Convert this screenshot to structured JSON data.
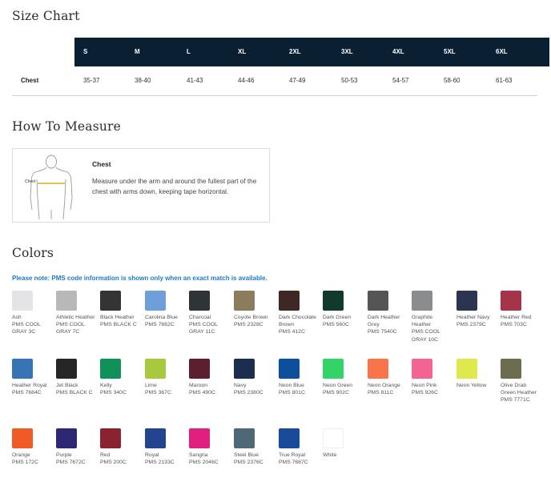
{
  "size_chart": {
    "title": "Size Chart",
    "sizes": [
      "S",
      "M",
      "L",
      "XL",
      "2XL",
      "3XL",
      "4XL",
      "5XL",
      "6XL"
    ],
    "row_label": "Chest",
    "chest_values": [
      "35-37",
      "38-40",
      "41-43",
      "44-46",
      "47-49",
      "50-53",
      "54-57",
      "58-60",
      "61-63"
    ]
  },
  "how_to_measure": {
    "title": "How To Measure",
    "figure_label": "Chest",
    "heading": "Chest",
    "text": "Measure under the arm and around the fullest part of the chest with arms down, keeping tape horizontal.",
    "accent_color": "#d6b21a"
  },
  "colors_section": {
    "title": "Colors",
    "note": "Please note: PMS code information is shown only when an exact match is available.",
    "note_color": "#1f78c8",
    "swatches": [
      {
        "name": "Ash",
        "pms": "PMS COOL GRAY 3C",
        "hex": "#e4e4e6"
      },
      {
        "name": "Athletic Heather",
        "pms": "PMS COOL GRAY 7C",
        "hex": "#b8b8b8"
      },
      {
        "name": "Black Heather",
        "pms": "PMS BLACK C",
        "hex": "#343434"
      },
      {
        "name": "Carolina Blue",
        "pms": "PMS 7682C",
        "hex": "#6f9fda"
      },
      {
        "name": "Charcoal",
        "pms": "PMS COOL GRAY 11C",
        "hex": "#2f3437"
      },
      {
        "name": "Coyote Brown",
        "pms": "PMS 2328C",
        "hex": "#8a7c5d"
      },
      {
        "name": "Dark Chocolate Brown",
        "pms": "PMS 412C",
        "hex": "#3f2725"
      },
      {
        "name": "Dark Green",
        "pms": "PMS 560C",
        "hex": "#103b2b"
      },
      {
        "name": "Dark Heather Grey",
        "pms": "PMS 7540C",
        "hex": "#535557"
      },
      {
        "name": "Graphite Heather",
        "pms": "PMS COOL GRAY 10C",
        "hex": "#8b8c8e"
      },
      {
        "name": "Heather Navy",
        "pms": "PMS 2379C",
        "hex": "#2c3550"
      },
      {
        "name": "Heather Red",
        "pms": "PMS 703C",
        "hex": "#a5344a"
      },
      {
        "name": "Heather Royal",
        "pms": "PMS 7684C",
        "hex": "#3674b5"
      },
      {
        "name": "Jet Black",
        "pms": "PMS BLACK C",
        "hex": "#262626"
      },
      {
        "name": "Kelly",
        "pms": "PMS 340C",
        "hex": "#11915a"
      },
      {
        "name": "Lime",
        "pms": "PMS 367C",
        "hex": "#a8c83d"
      },
      {
        "name": "Maroon",
        "pms": "PMS 490C",
        "hex": "#5b1f30"
      },
      {
        "name": "Navy",
        "pms": "PMS 2380C",
        "hex": "#1b2e4d"
      },
      {
        "name": "Neon Blue",
        "pms": "PMS 801C",
        "hex": "#0d4f9a"
      },
      {
        "name": "Neon Green",
        "pms": "PMS 902C",
        "hex": "#33d467"
      },
      {
        "name": "Neon Orange",
        "pms": "PMS 811C",
        "hex": "#f8754b"
      },
      {
        "name": "Neon Pink",
        "pms": "PMS 926C",
        "hex": "#f26593"
      },
      {
        "name": "Neon Yellow",
        "pms": "",
        "hex": "#dfe84c"
      },
      {
        "name": "Olive Drab Green Heather",
        "pms": "PMS 7771C",
        "hex": "#6c6c4f"
      },
      {
        "name": "Orange",
        "pms": "PMS 172C",
        "hex": "#ef5a27"
      },
      {
        "name": "Purple",
        "pms": "PMS 7672C",
        "hex": "#2e2773"
      },
      {
        "name": "Red",
        "pms": "PMS 200C",
        "hex": "#8a2230"
      },
      {
        "name": "Royal",
        "pms": "PMS 2133C",
        "hex": "#25448f"
      },
      {
        "name": "Sangria",
        "pms": "PMS 2046C",
        "hex": "#e01f7e"
      },
      {
        "name": "Steel Blue",
        "pms": "PMS 2376C",
        "hex": "#4f6878"
      },
      {
        "name": "True Royal",
        "pms": "PMS 7687C",
        "hex": "#1a4a9a"
      },
      {
        "name": "White",
        "pms": "",
        "hex": "#ffffff"
      }
    ]
  }
}
